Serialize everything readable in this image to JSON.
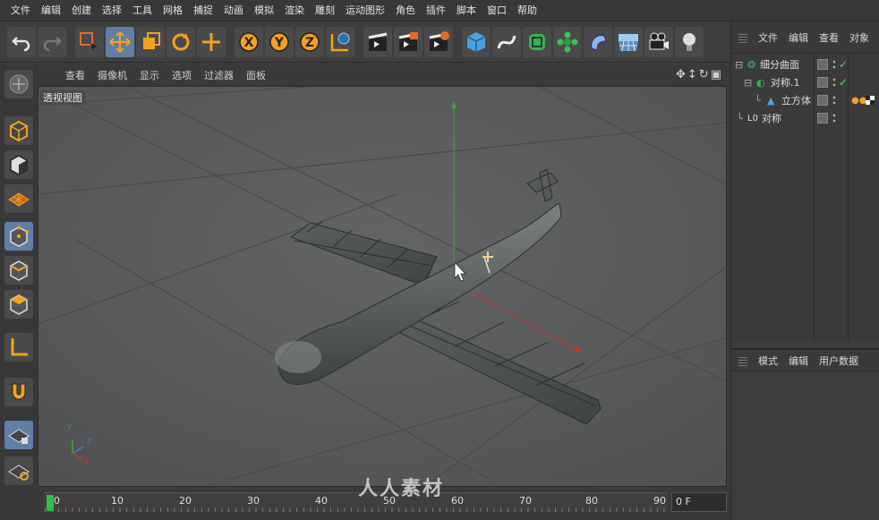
{
  "menu": [
    "文件",
    "编辑",
    "创建",
    "选择",
    "工具",
    "网格",
    "捕捉",
    "动画",
    "模拟",
    "渲染",
    "雕刻",
    "运动图形",
    "角色",
    "插件",
    "脚本",
    "窗口",
    "帮助"
  ],
  "viewport": {
    "menu": [
      "查看",
      "摄像机",
      "显示",
      "选项",
      "过滤器",
      "面板"
    ],
    "title": "透视视图"
  },
  "objects_panel": {
    "menu": [
      "文件",
      "编辑",
      "查看",
      "对象"
    ],
    "items": [
      {
        "name": "细分曲面",
        "depth": 0
      },
      {
        "name": "对称.1",
        "depth": 1
      },
      {
        "name": "立方体",
        "depth": 2
      },
      {
        "name": "对称",
        "depth": 0
      }
    ]
  },
  "attributes_panel": {
    "menu": [
      "模式",
      "编辑",
      "用户数据"
    ]
  },
  "timeline": {
    "ticks": [
      "0",
      "10",
      "20",
      "30",
      "40",
      "50",
      "60",
      "70",
      "80",
      "90"
    ],
    "frame_field": "0 F"
  },
  "watermark": "人人素材",
  "axis_labels": {
    "y": "Y",
    "z": "Z",
    "x": "X"
  }
}
